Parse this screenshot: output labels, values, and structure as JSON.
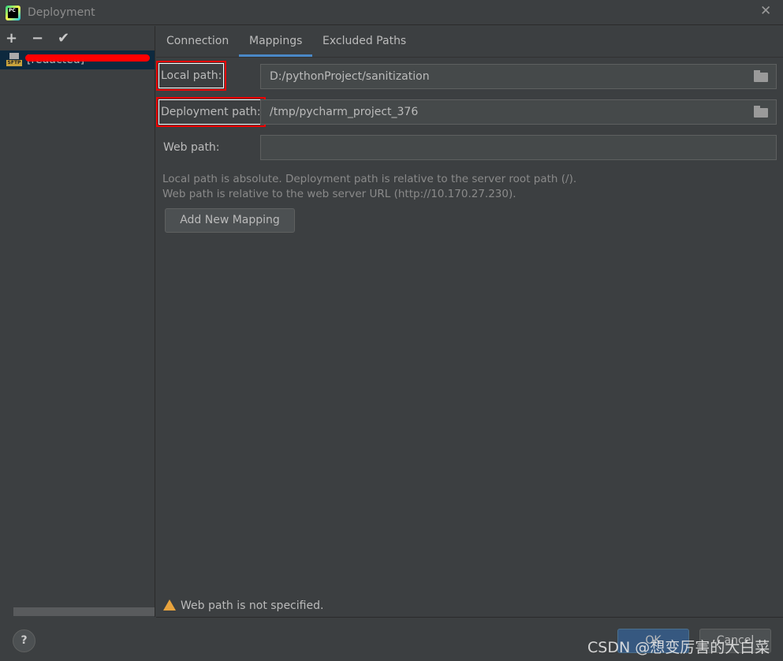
{
  "window": {
    "title": "Deployment",
    "close_icon": "close-icon"
  },
  "sidebar": {
    "toolbar": {
      "add": "+",
      "remove": "−",
      "apply": "✔"
    },
    "server": {
      "type_badge": "SFTP",
      "name": "[redacted]"
    }
  },
  "tabs": [
    {
      "label": "Connection"
    },
    {
      "label": "Mappings",
      "active": true
    },
    {
      "label": "Excluded Paths"
    }
  ],
  "mappings": {
    "local_path": {
      "label": "Local path:",
      "value": "D:/pythonProject/sanitization"
    },
    "deployment_path": {
      "label": "Deployment path:",
      "value": "/tmp/pycharm_project_376"
    },
    "web_path": {
      "label": "Web path:",
      "value": ""
    },
    "help_line1": "Local path is absolute. Deployment path is relative to the server root path (/).",
    "help_line2": "Web path is relative to the web server URL (http://10.170.27.230).",
    "add_button": "Add New Mapping"
  },
  "warning": "Web path is not specified.",
  "footer": {
    "help": "?",
    "ok": "OK",
    "cancel": "Cancel"
  },
  "watermark": "CSDN @想变厉害的大白菜",
  "colors": {
    "background": "#3c3f41",
    "accent": "#4a88c7",
    "selection": "#0d293e",
    "highlight_box": "#e00000",
    "warning": "#e8a33d"
  }
}
